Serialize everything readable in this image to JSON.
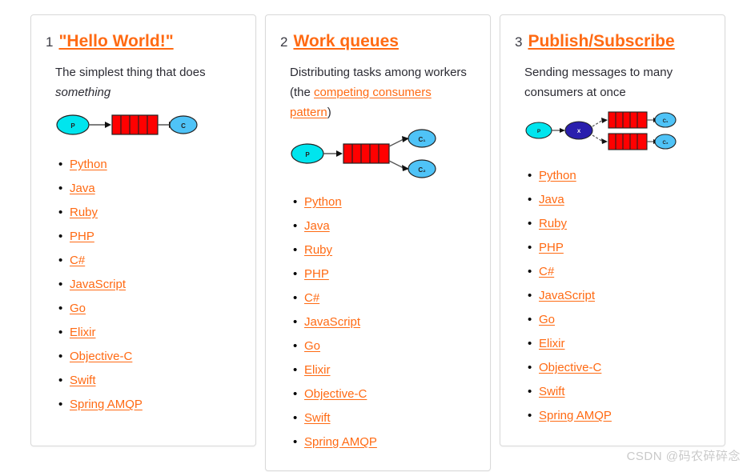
{
  "page": {
    "watermark": "CSDN @码农碎碎念",
    "accent_color": "#ff6a13",
    "text_color": "#2b2b33",
    "card_border_color": "#d9d9d9",
    "background": "#ffffff"
  },
  "diagram_colors": {
    "producer_fill": "#00e5ee",
    "consumer_fill": "#4fc3f7",
    "queue_fill": "#ff0000",
    "exchange_fill": "#2a1fad",
    "stroke": "#222222",
    "arrow": "#555555"
  },
  "cards": [
    {
      "number": "1",
      "title": "\"Hello World!\"",
      "desc_prefix": "The simplest thing that does ",
      "desc_italic": "something",
      "desc_link": "",
      "desc_suffix": "",
      "diagram": {
        "type": "producer-queue-consumer",
        "producer_label": "P",
        "consumer_labels": [
          "C"
        ],
        "queue_count": 1,
        "queue_cells": 5
      },
      "languages": [
        "Python",
        "Java",
        "Ruby",
        "PHP",
        "C#",
        "JavaScript",
        "Go",
        "Elixir",
        "Objective-C",
        "Swift",
        "Spring AMQP"
      ]
    },
    {
      "number": "2",
      "title": "Work queues",
      "desc_prefix": "Distributing tasks among workers (the ",
      "desc_italic": "",
      "desc_link": "competing consumers pattern",
      "desc_suffix": ")",
      "diagram": {
        "type": "producer-queue-two-consumers",
        "producer_label": "P",
        "consumer_labels": [
          "C₁",
          "C₂"
        ],
        "queue_count": 1,
        "queue_cells": 5
      },
      "languages": [
        "Python",
        "Java",
        "Ruby",
        "PHP",
        "C#",
        "JavaScript",
        "Go",
        "Elixir",
        "Objective-C",
        "Swift",
        "Spring AMQP"
      ]
    },
    {
      "number": "3",
      "title": "Publish/Subscribe",
      "desc_prefix": "Sending messages to many consumers at once",
      "desc_italic": "",
      "desc_link": "",
      "desc_suffix": "",
      "diagram": {
        "type": "producer-exchange-two-queues",
        "producer_label": "P",
        "exchange_label": "X",
        "consumer_labels": [
          "C₁",
          "C₂"
        ],
        "queue_count": 2,
        "queue_cells": 5
      },
      "languages": [
        "Python",
        "Java",
        "Ruby",
        "PHP",
        "C#",
        "JavaScript",
        "Go",
        "Elixir",
        "Objective-C",
        "Swift",
        "Spring AMQP"
      ]
    }
  ]
}
